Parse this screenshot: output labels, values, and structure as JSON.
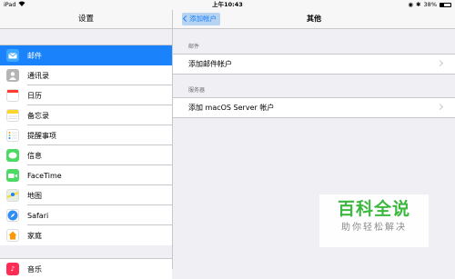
{
  "status_bar": {
    "device": "iPad",
    "time": "上午10:43",
    "battery": "38%"
  },
  "left": {
    "title": "设置",
    "items": [
      {
        "label": "邮件",
        "icon": "mail-icon",
        "color": "#1a82fb",
        "selected": true
      },
      {
        "label": "通讯录",
        "icon": "contacts-icon",
        "color": "#8e8e93"
      },
      {
        "label": "日历",
        "icon": "calendar-icon",
        "color": "#ffffff"
      },
      {
        "label": "备忘录",
        "icon": "notes-icon",
        "color": "#fed52b"
      },
      {
        "label": "提醒事项",
        "icon": "reminders-icon",
        "color": "#ffffff"
      },
      {
        "label": "信息",
        "icon": "messages-icon",
        "color": "#4cd964"
      },
      {
        "label": "FaceTime",
        "icon": "facetime-icon",
        "color": "#4cd964"
      },
      {
        "label": "地图",
        "icon": "maps-icon",
        "color": "#6dbb6d"
      },
      {
        "label": "Safari",
        "icon": "safari-icon",
        "color": "#2f8ef6"
      },
      {
        "label": "家庭",
        "icon": "home-icon",
        "color": "#ffffff"
      }
    ],
    "next_section_item": {
      "label": "音乐",
      "icon": "music-icon",
      "color": "#ff2d55"
    }
  },
  "right": {
    "back_label": "添加帐户",
    "title": "其他",
    "sections": [
      {
        "header": "邮件",
        "row": "添加邮件帐户"
      },
      {
        "header": "服务器",
        "row": "添加 macOS Server 帐户"
      }
    ]
  },
  "watermark": {
    "line1": "百科全说",
    "line2": "助你轻松解决"
  }
}
